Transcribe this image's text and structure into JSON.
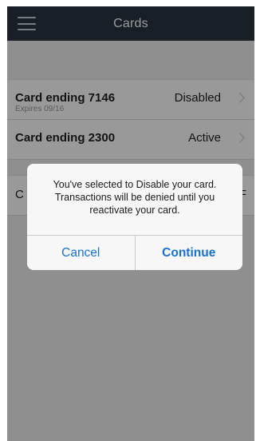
{
  "navbar": {
    "title": "Cards",
    "menu_icon": "hamburger-menu-icon"
  },
  "cards": [
    {
      "title": "Card ending 7146",
      "subtitle": "Expires 09/16",
      "status": "Disabled",
      "chevron_icon": "chevron-right-icon"
    },
    {
      "title": "Card ending 2300",
      "status": "Active",
      "chevron_icon": "chevron-right-icon"
    }
  ],
  "obscured_row": {
    "left_text": "C",
    "right_text": "F"
  },
  "alert": {
    "message": "You've selected to Disable your card. Transactions will be denied until you reactivate your card.",
    "cancel_label": "Cancel",
    "continue_label": "Continue"
  },
  "colors": {
    "navbar_bg": "#2b3540",
    "accent_link": "#1472d6"
  }
}
